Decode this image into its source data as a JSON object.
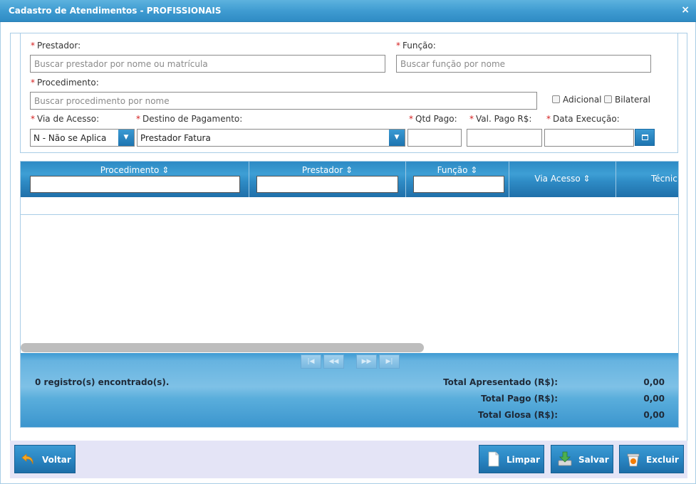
{
  "window": {
    "title": "Cadastro de Atendimentos - PROFISSIONAIS",
    "close_label": "×"
  },
  "form": {
    "prestador": {
      "label": "Prestador:",
      "placeholder": "Buscar prestador por nome ou matrícula"
    },
    "funcao": {
      "label": "Função:",
      "placeholder": "Buscar função por nome"
    },
    "procedimento": {
      "label": "Procedimento:",
      "placeholder": "Buscar procedimento por nome"
    },
    "adicional_label": "Adicional",
    "bilateral_label": "Bilateral",
    "via_acesso": {
      "label": "Via de Acesso:",
      "value": "N - Não se Aplica"
    },
    "destino_pagamento": {
      "label": "Destino de Pagamento:",
      "value": "Prestador Fatura"
    },
    "qtd_pago": {
      "label": "Qtd Pago:",
      "value": ""
    },
    "val_pago": {
      "label": "Val. Pago R$:",
      "value": ""
    },
    "data_execucao": {
      "label": "Data Execução:",
      "value": ""
    },
    "required_mark": "*"
  },
  "grid": {
    "columns": [
      {
        "label": "Procedimento",
        "sort_icon": "sort-icon"
      },
      {
        "label": "Prestador",
        "sort_icon": "sort-icon"
      },
      {
        "label": "Função",
        "sort_icon": "sort-icon"
      },
      {
        "label": "Via Acesso",
        "sort_icon": "sort-icon"
      },
      {
        "label": "Técnic"
      }
    ],
    "sort_glyph": "⇕",
    "pager": {
      "first": "|◀",
      "prev": "◀◀",
      "next": "▶▶",
      "last": "▶|"
    },
    "records_text": "0 registro(s) encontrado(s).",
    "totals": [
      {
        "label": "Total Apresentado (R$):",
        "value": "0,00"
      },
      {
        "label": "Total Pago (R$):",
        "value": "0,00"
      },
      {
        "label": "Total Glosa (R$):",
        "value": "0,00"
      }
    ]
  },
  "footer": {
    "voltar_label": "Voltar",
    "limpar_label": "Limpar",
    "salvar_label": "Salvar",
    "excluir_label": "Excluir"
  }
}
